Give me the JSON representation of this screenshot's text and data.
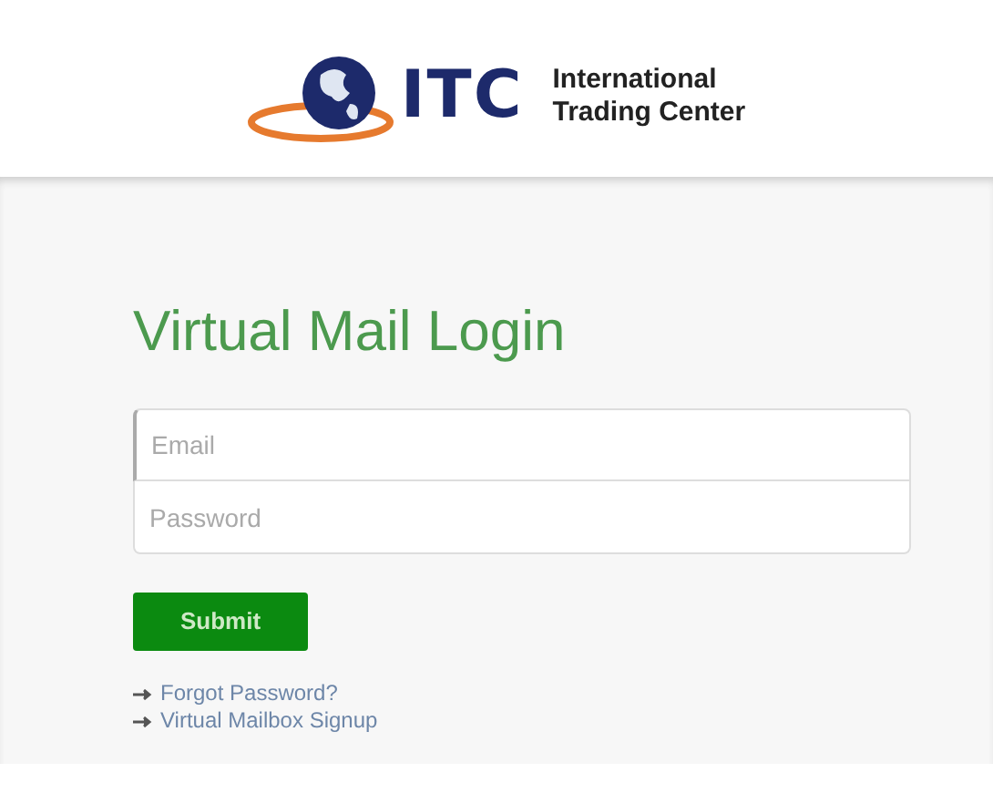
{
  "logo": {
    "abbreviation": "ITC",
    "name_lines": [
      "International",
      "Trading Center"
    ]
  },
  "login": {
    "title": "Virtual Mail Login",
    "fields": [
      {
        "placeholder": "Email",
        "focused": true
      },
      {
        "placeholder": "Password",
        "focused": false
      }
    ],
    "submit": "Submit",
    "links": [
      "Forgot Password?",
      "Virtual Mailbox Signup"
    ]
  }
}
